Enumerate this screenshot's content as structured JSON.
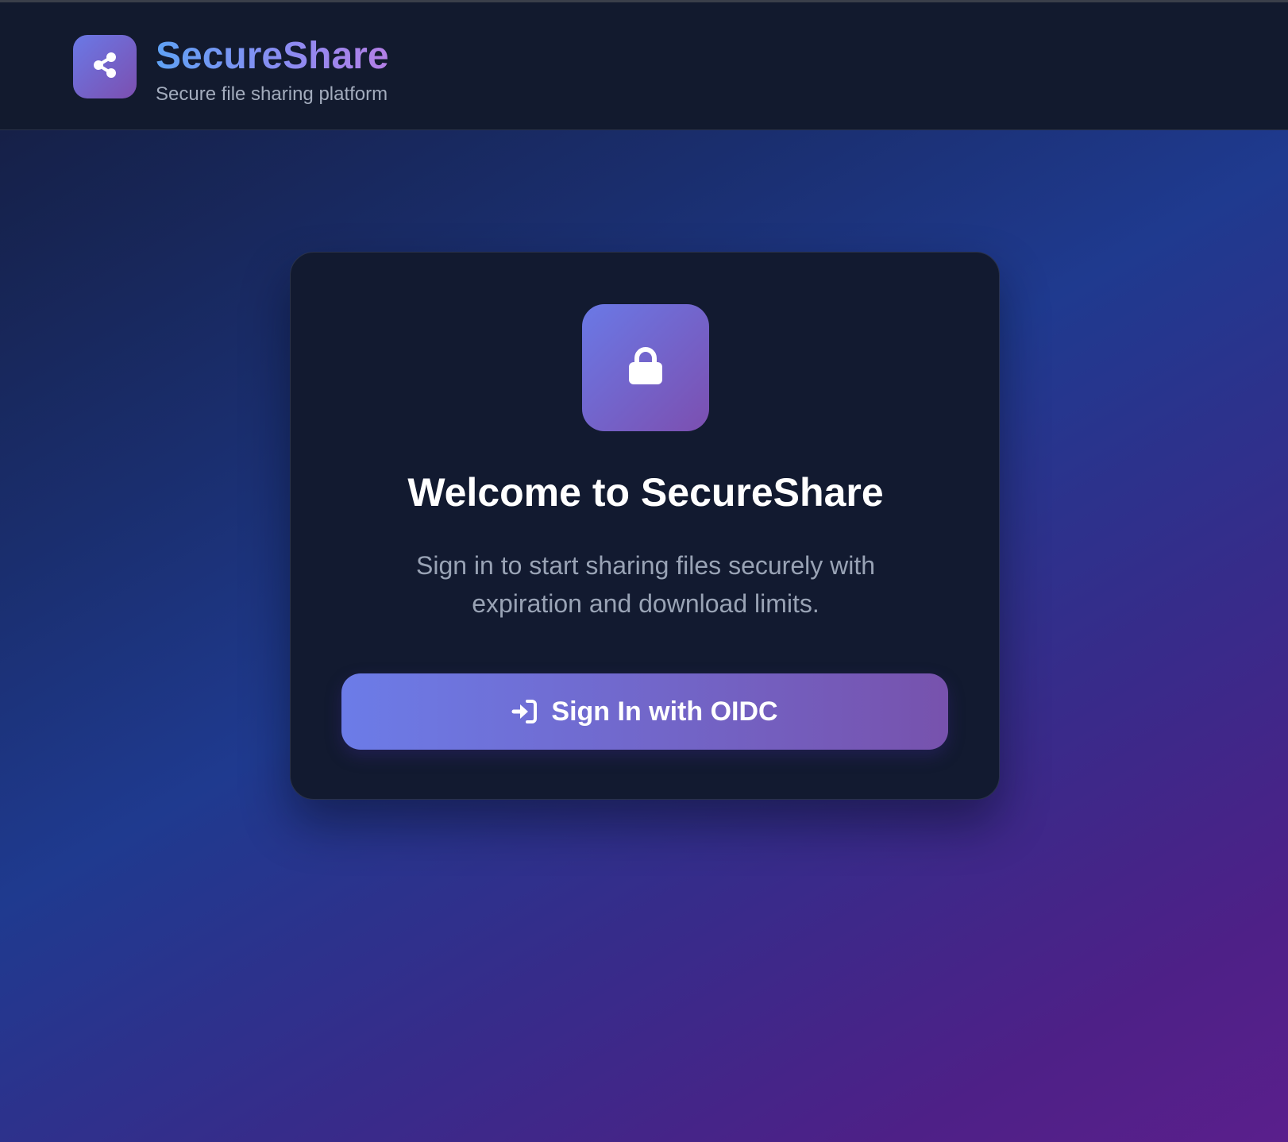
{
  "header": {
    "app_name": "SecureShare",
    "tagline": "Secure file sharing platform",
    "logo_icon": "share-icon"
  },
  "card": {
    "icon": "lock-icon",
    "title": "Welcome to SecureShare",
    "description": "Sign in to start sharing files securely with expiration and download limits.",
    "signin_button": {
      "label": "Sign In with OIDC",
      "icon": "sign-in-icon"
    }
  },
  "colors": {
    "accent_gradient_start": "#6a79e6",
    "accent_gradient_end": "#7c4fb0",
    "header_background": "#121a2e",
    "card_background": "#121a30"
  }
}
